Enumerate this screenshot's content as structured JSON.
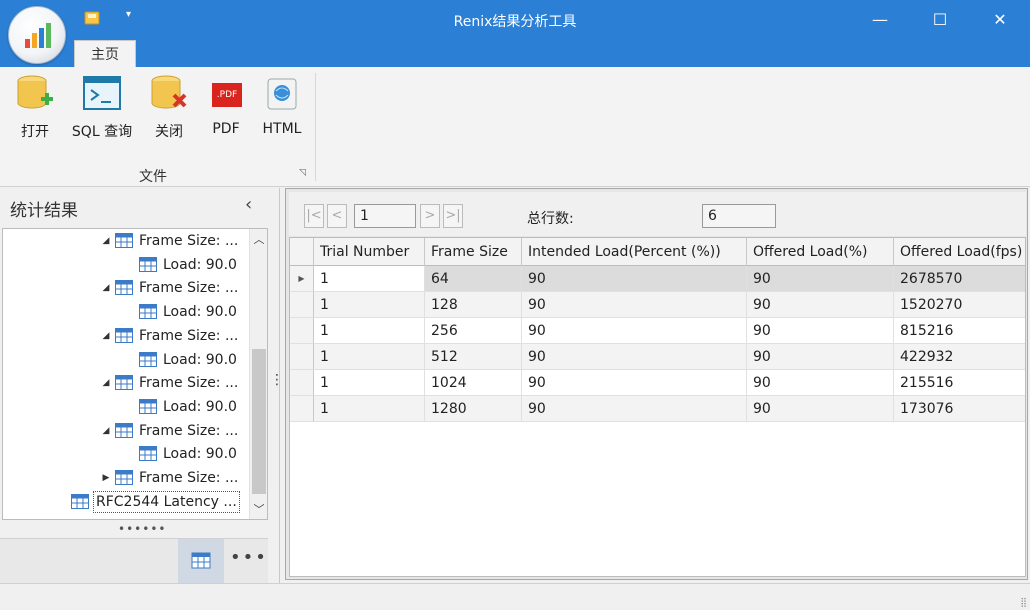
{
  "window": {
    "title": "Renix结果分析工具",
    "home_tab": "主页",
    "minimize": "—",
    "maximize": "☐",
    "close": "✕",
    "qat_dropdown": "▾"
  },
  "ribbon": {
    "buttons": [
      {
        "label": "打开",
        "icon": "open-database-icon"
      },
      {
        "label": "SQL 查询",
        "icon": "terminal-icon"
      },
      {
        "label": "关闭",
        "icon": "close-database-icon"
      },
      {
        "label": "PDF",
        "icon": "pdf-icon"
      },
      {
        "label": "HTML",
        "icon": "html-icon"
      }
    ],
    "group_label": "文件",
    "pdf_badge": ".PDF",
    "launcher": "◹"
  },
  "left_panel": {
    "title": "统计结果",
    "collapse": "‹",
    "tree": [
      {
        "label": "Frame Size: ...",
        "level": 1,
        "expander": "◢"
      },
      {
        "label": "Load: 90.0",
        "level": 2,
        "expander": ""
      },
      {
        "label": "Frame Size: ...",
        "level": 1,
        "expander": "◢"
      },
      {
        "label": "Load: 90.0",
        "level": 2,
        "expander": ""
      },
      {
        "label": "Frame Size: ...",
        "level": 1,
        "expander": "◢"
      },
      {
        "label": "Load: 90.0",
        "level": 2,
        "expander": ""
      },
      {
        "label": "Frame Size: ...",
        "level": 1,
        "expander": "◢"
      },
      {
        "label": "Load: 90.0",
        "level": 2,
        "expander": ""
      },
      {
        "label": "Frame Size: ...",
        "level": 1,
        "expander": "◢"
      },
      {
        "label": "Load: 90.0",
        "level": 2,
        "expander": ""
      },
      {
        "label": "Frame Size: ...",
        "level": 1,
        "expander": "▶"
      },
      {
        "label": "RFC2544 Latency ...",
        "level": 0,
        "expander": "",
        "selected": true
      }
    ],
    "splitter": "••••••",
    "more": "•••",
    "scroll_up": "︿",
    "scroll_down": "﹀",
    "vertical_handle": "⋮"
  },
  "toolbar": {
    "first": "|<",
    "prev": "<",
    "page": "1",
    "next": ">",
    "last": ">|",
    "total_label": "总行数:",
    "total_value": "6"
  },
  "grid": {
    "columns": [
      "Trial Number",
      "Frame Size",
      "Intended Load(Percent (%))",
      "Offered Load(%)",
      "Offered Load(fps)"
    ],
    "rows": [
      [
        "1",
        "64",
        "90",
        "90",
        "2678570"
      ],
      [
        "1",
        "128",
        "90",
        "90",
        "1520270"
      ],
      [
        "1",
        "256",
        "90",
        "90",
        "815216"
      ],
      [
        "1",
        "512",
        "90",
        "90",
        "422932"
      ],
      [
        "1",
        "1024",
        "90",
        "90",
        "215516"
      ],
      [
        "1",
        "1280",
        "90",
        "90",
        "173076"
      ]
    ],
    "current_row_marker": "▶",
    "scroll_left": "<",
    "scroll_right": ">"
  },
  "statusbar": {
    "grip": "⣿"
  }
}
